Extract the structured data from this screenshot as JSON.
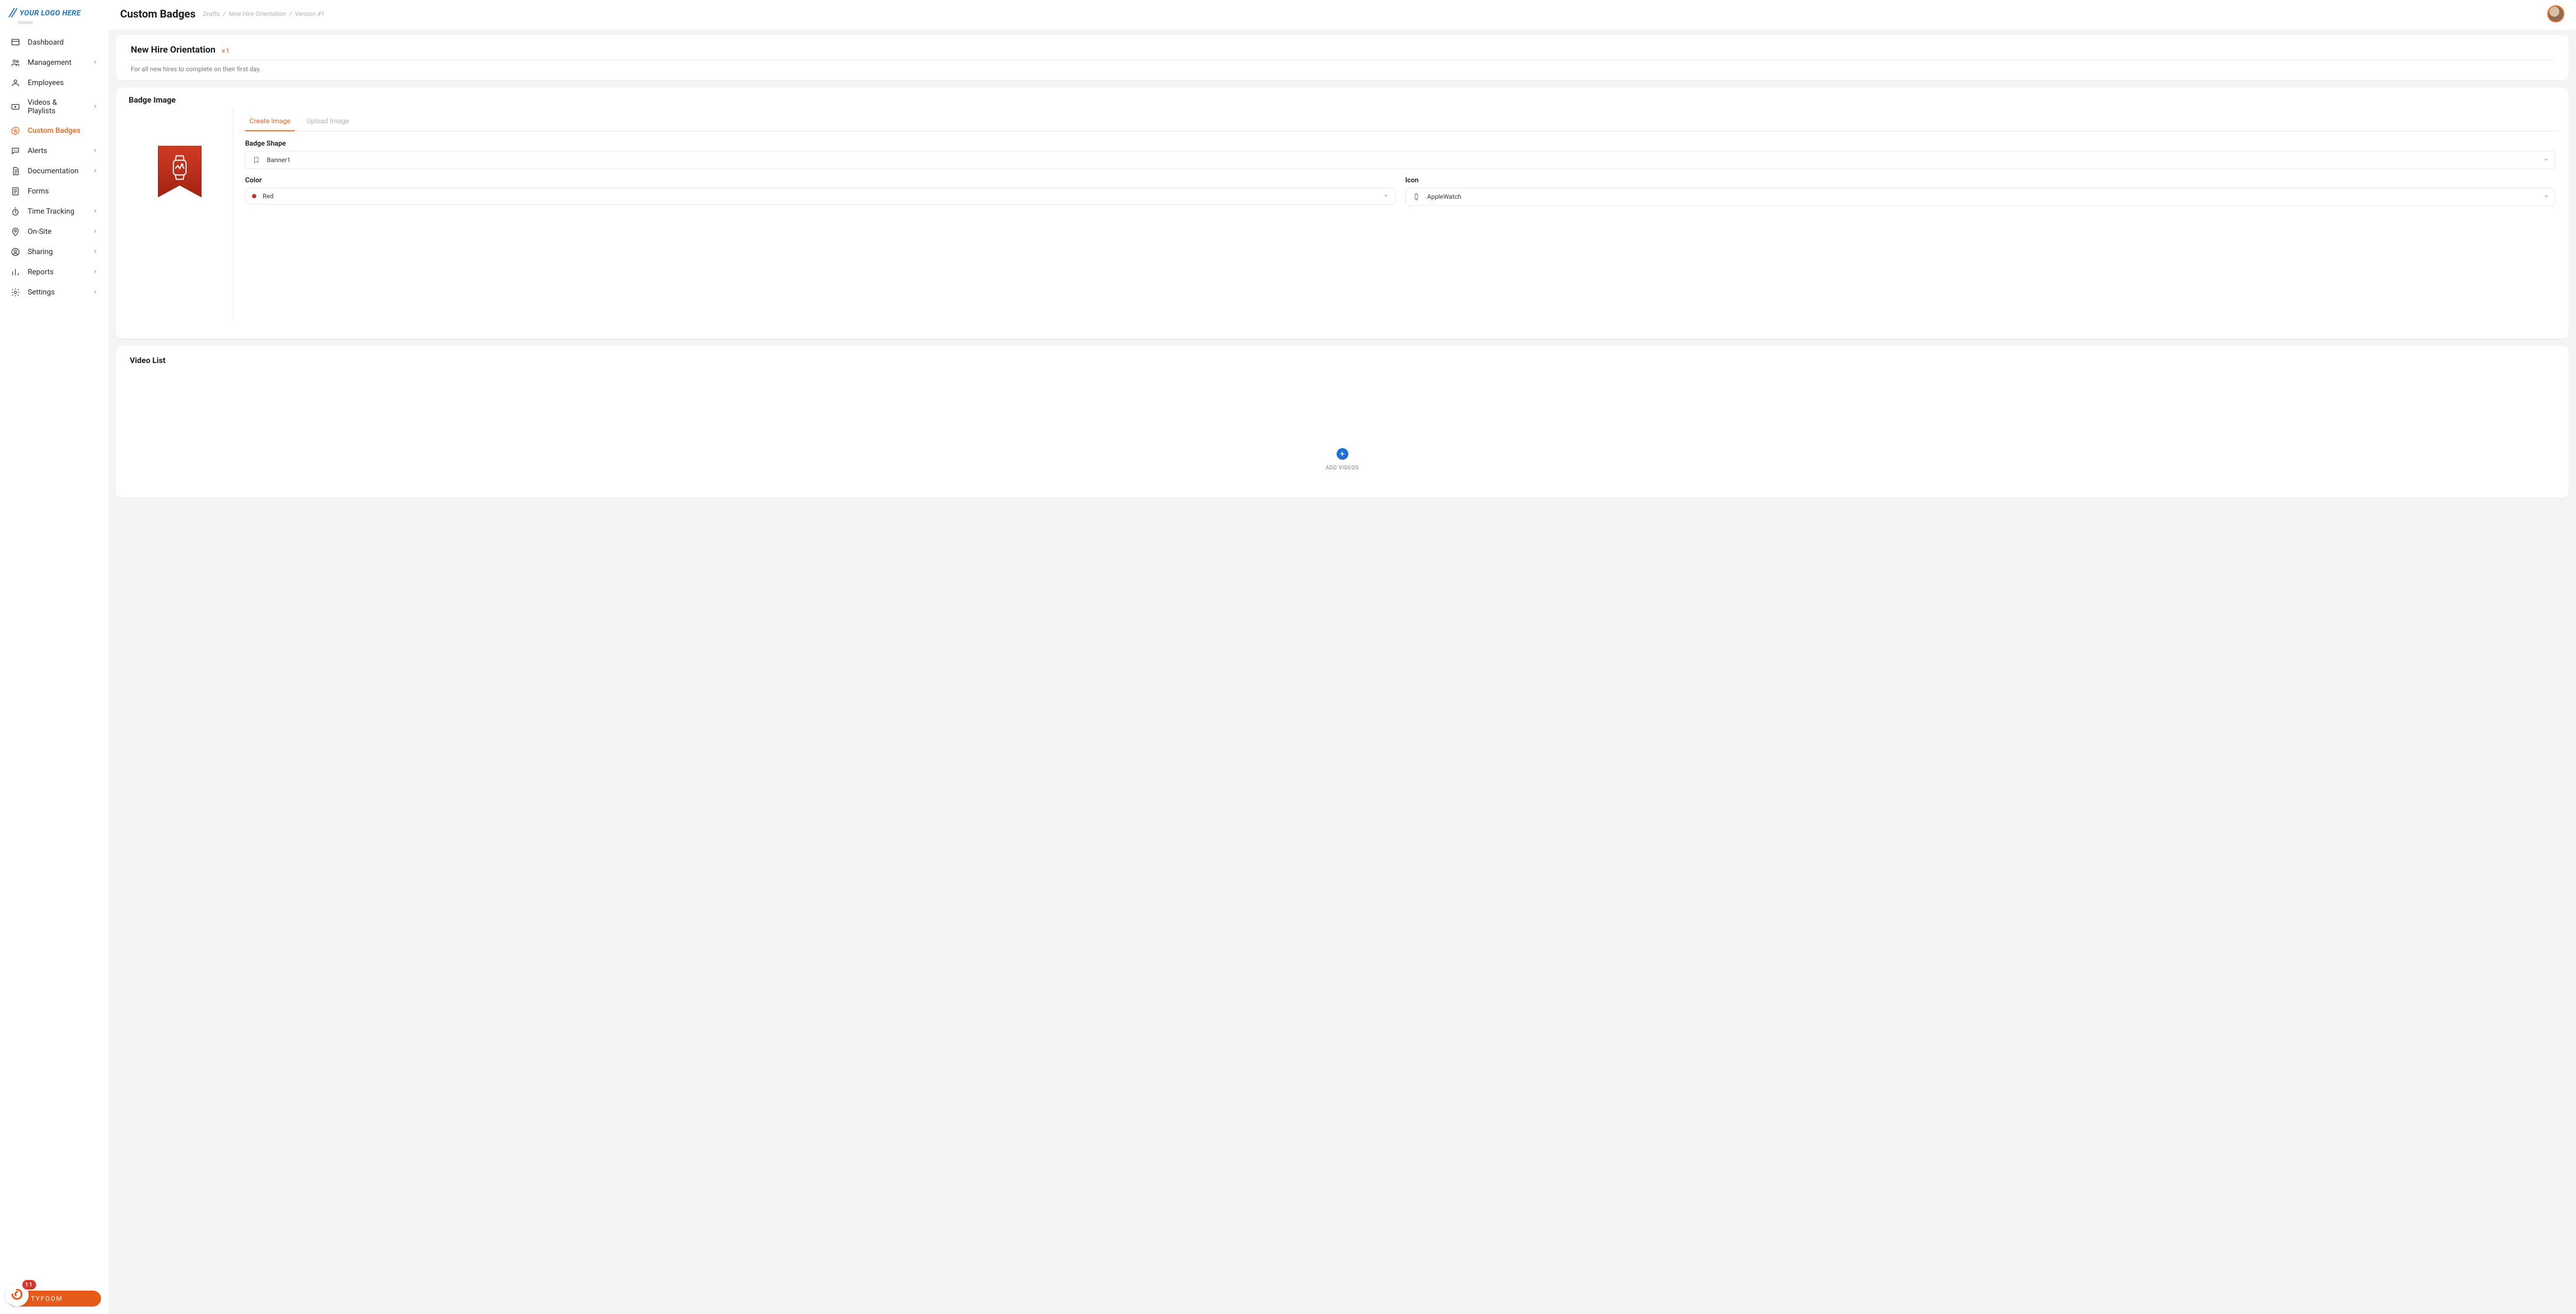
{
  "logo": {
    "text": "YOUR LOGO HERE",
    "sub": "Orientor"
  },
  "sidebar": {
    "items": [
      {
        "label": "Dashboard",
        "chev": false,
        "active": false
      },
      {
        "label": "Management",
        "chev": true,
        "active": false
      },
      {
        "label": "Employees",
        "chev": false,
        "active": false
      },
      {
        "label": "Videos & Playlists",
        "chev": true,
        "active": false
      },
      {
        "label": "Custom Badges",
        "chev": false,
        "active": true
      },
      {
        "label": "Alerts",
        "chev": true,
        "active": false
      },
      {
        "label": "Documentation",
        "chev": true,
        "active": false
      },
      {
        "label": "Forms",
        "chev": false,
        "active": false
      },
      {
        "label": "Time Tracking",
        "chev": true,
        "active": false
      },
      {
        "label": "On-Site",
        "chev": true,
        "active": false
      },
      {
        "label": "Sharing",
        "chev": true,
        "active": false
      },
      {
        "label": "Reports",
        "chev": true,
        "active": false
      },
      {
        "label": "Settings",
        "chev": true,
        "active": false
      }
    ],
    "brand_pill": {
      "label": "TYFOOM",
      "badge": "11"
    }
  },
  "header": {
    "page_title": "Custom Badges",
    "breadcrumb": [
      "Drafts",
      "New Hire Orientation",
      "Version #1"
    ]
  },
  "badge": {
    "title": "New Hire Orientation",
    "version": "v.1",
    "description": "For all new hires to complete on their first day.",
    "section_image": "Badge Image",
    "tabs": {
      "create": "Create Image",
      "upload": "Upload Image",
      "active": "create"
    },
    "shape": {
      "label": "Badge Shape",
      "value": "Banner1"
    },
    "color": {
      "label": "Color",
      "value": "Red",
      "hex": "#c23324"
    },
    "icon": {
      "label": "Icon",
      "value": "AppleWatch"
    }
  },
  "videos": {
    "section_title": "Video List",
    "add_label": "ADD VIDEOS"
  }
}
